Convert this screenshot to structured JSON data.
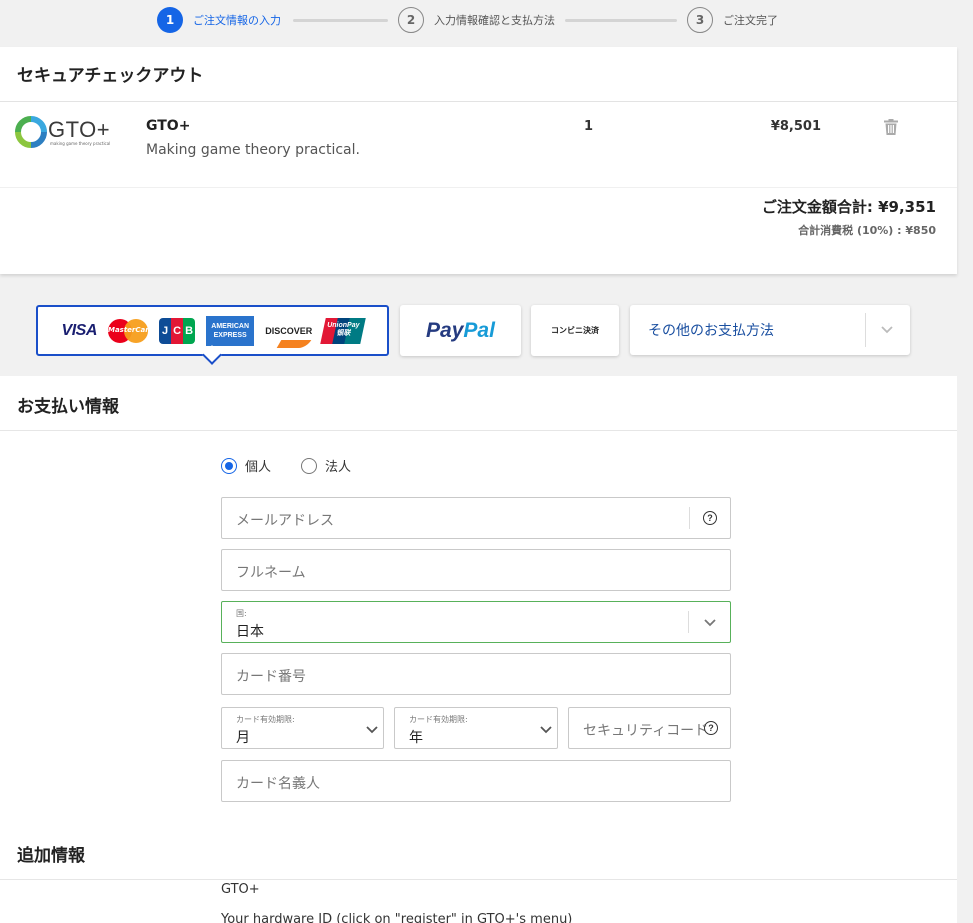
{
  "stepper": {
    "steps": [
      {
        "number": "1",
        "label": "ご注文情報の入力",
        "active": true
      },
      {
        "number": "2",
        "label": "入力情報確認と支払方法",
        "active": false
      },
      {
        "number": "3",
        "label": "ご注文完了",
        "active": false
      }
    ]
  },
  "checkout": {
    "title": "セキュアチェックアウト",
    "item": {
      "logo_text": "GTO+",
      "logo_tagline": "making game theory practical",
      "name": "GTO+",
      "description": "Making game theory practical.",
      "quantity": "1",
      "price": "¥8,501"
    },
    "total_label": "ご注文金額合計: ¥9,351",
    "tax_label": "合計消費税 (10%) : ¥850"
  },
  "payment_methods": {
    "cards": {
      "visa": "VISA",
      "mastercard": "MasterCard",
      "jcb": [
        "J",
        "C",
        "B"
      ],
      "amex": [
        "AMERICAN",
        "EXPRESS"
      ],
      "discover": "DISCOVER",
      "unionpay": [
        "UnionPay",
        "银联"
      ]
    },
    "paypal": {
      "part1": "Pay",
      "part2": "Pal"
    },
    "konbini": "コンビニ決済",
    "other": "その他のお支払方法"
  },
  "payment_info": {
    "title": "お支払い情報",
    "customer_types": [
      "個人",
      "法人"
    ],
    "email_placeholder": "メールアドレス",
    "fullname_placeholder": "フルネーム",
    "country_label": "国:",
    "country_value": "日本",
    "card_number_placeholder": "カード番号",
    "expiry_label": "カード有効期限:",
    "month_value": "月",
    "year_value": "年",
    "cvc_placeholder": "セキュリティコード",
    "cardholder_placeholder": "カード名義人",
    "help_glyph": "?"
  },
  "additional_info": {
    "title": "追加情報",
    "product_line": "GTO+",
    "hardware_line": "Your hardware ID (click on \"register\" in GTO+'s menu)"
  },
  "colors": {
    "accent": "#1565e6",
    "selected_border": "#1a4fc9",
    "valid_border": "#58b15a"
  }
}
